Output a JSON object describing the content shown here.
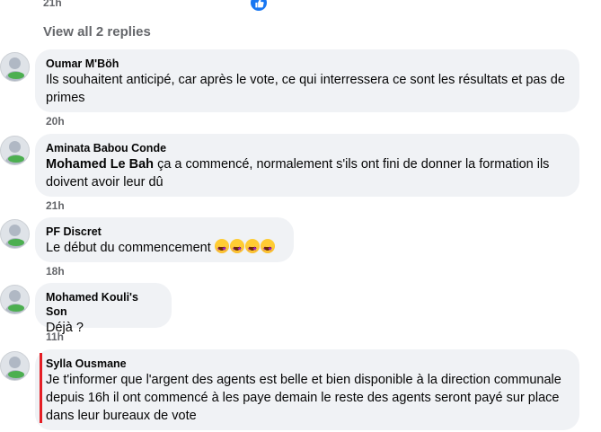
{
  "top": {
    "time": "21h"
  },
  "view_replies": "View all 2 replies",
  "comments": [
    {
      "author": "Oumar M'Böh",
      "text": "Ils souhaitent anticipé, car après le vote, ce qui interressera ce sont les résultats et pas de primes",
      "time": "20h"
    },
    {
      "author": "Aminata Babou Conde",
      "mention": "Mohamed Le Bah",
      "text": " ça a commencé, normalement s'ils ont fini de donner la formation ils doivent avoir leur dû",
      "time": "21h"
    },
    {
      "author": "PF Discret",
      "text": "Le début du commencement ",
      "emoji_icon": "star-struck-emoji",
      "emoji_count": 4,
      "time": "18h"
    },
    {
      "author": "Mohamed Kouli's Son",
      "text": "Déjà ?",
      "time": "11h"
    },
    {
      "author": "Sylla Ousmane",
      "text": "Je t'informer que l'argent des agents est belle et bien disponible à la direction communale depuis 16h il ont commencé à les paye demain le reste des agents seront payé sur place dans leur bureaux de vote"
    }
  ],
  "colors": {
    "bubble_bg": "#f0f2f5",
    "meta_text": "#65676b",
    "like_blue": "#1877f2",
    "highlight_red": "#e41e25"
  }
}
